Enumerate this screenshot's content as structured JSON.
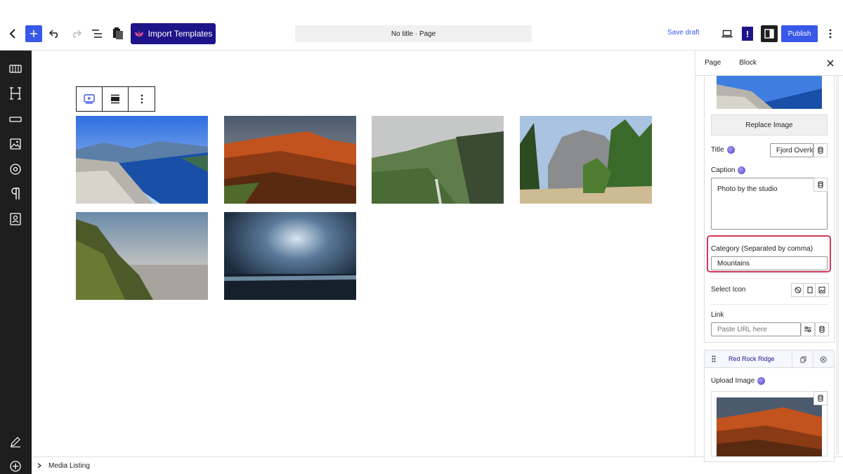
{
  "topbar": {
    "import_label": "Import Templates",
    "doc_title": "No title · Page",
    "save_draft": "Save draft",
    "publish": "Publish",
    "warn": "!"
  },
  "gallery": {
    "images": [
      {
        "alt": "fjord"
      },
      {
        "alt": "red rock"
      },
      {
        "alt": "green valley"
      },
      {
        "alt": "forest cliffs"
      },
      {
        "alt": "coast"
      },
      {
        "alt": "storm sea"
      }
    ]
  },
  "footer": {
    "breadcrumb": "Media Listing"
  },
  "panel": {
    "tab_page": "Page",
    "tab_block": "Block",
    "replace_image": "Replace Image",
    "title_label": "Title",
    "title_value": "Fjord Overlc",
    "caption_label": "Caption",
    "caption_value": "Photo by the studio",
    "category_label": "Category (Separated by comma)",
    "category_value": "Mountains",
    "select_icon_label": "Select Icon",
    "link_label": "Link",
    "link_placeholder": "Paste URL here",
    "item2_name": "Red Rock Ridge",
    "upload_image_label": "Upload Image"
  },
  "colors": {
    "accent": "#3858e9",
    "import_bg": "#1e1489",
    "highlight": "#d0375a",
    "rail_bg": "#1e1e1e"
  }
}
